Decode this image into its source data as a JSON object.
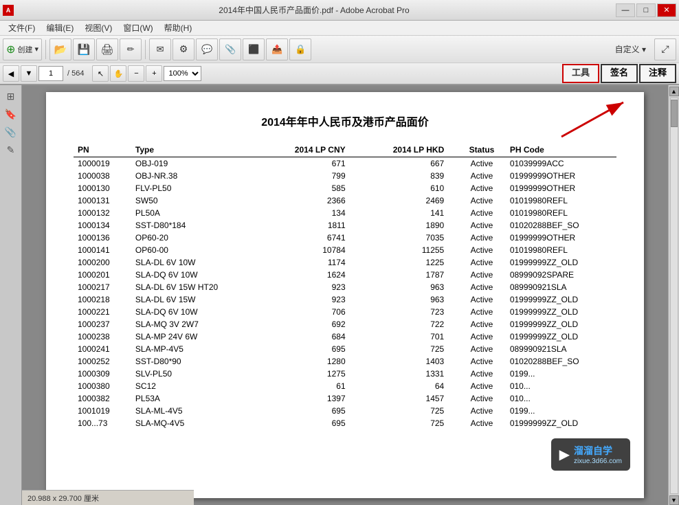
{
  "titlebar": {
    "title": "2014年中国人民币产品面价.pdf - Adobe Acrobat Pro",
    "icon_text": "A",
    "minimize": "—",
    "restore": "□",
    "close": "✕"
  },
  "menubar": {
    "items": [
      "文件(F)",
      "编辑(E)",
      "视图(V)",
      "窗口(W)",
      "帮助(H)"
    ]
  },
  "toolbar": {
    "create_label": "创建",
    "customize_label": "自定义 ▾"
  },
  "navtoolbar": {
    "page_current": "1",
    "page_total": "/ 564",
    "zoom_value": "100%",
    "tools_label": "工具",
    "sign_label": "签名",
    "annotate_label": "注释"
  },
  "pdf": {
    "title": "2014年年中人民币及港币产品面价",
    "columns": [
      "PN",
      "Type",
      "2014 LP CNY",
      "2014 LP HKD",
      "Status",
      "PH Code"
    ],
    "rows": [
      {
        "pn": "1000019",
        "type": "OBJ-019",
        "cny": "671",
        "hkd": "667",
        "status": "Active",
        "ph": "01039999ACC"
      },
      {
        "pn": "1000038",
        "type": "OBJ-NR.38",
        "cny": "799",
        "hkd": "839",
        "status": "Active",
        "ph": "01999999OTHER"
      },
      {
        "pn": "1000130",
        "type": "FLV-PL50",
        "cny": "585",
        "hkd": "610",
        "status": "Active",
        "ph": "01999999OTHER"
      },
      {
        "pn": "1000131",
        "type": "SW50",
        "cny": "2366",
        "hkd": "2469",
        "status": "Active",
        "ph": "01019980REFL"
      },
      {
        "pn": "1000132",
        "type": "PL50A",
        "cny": "134",
        "hkd": "141",
        "status": "Active",
        "ph": "01019980REFL"
      },
      {
        "pn": "1000134",
        "type": "SST-D80*184",
        "cny": "1811",
        "hkd": "1890",
        "status": "Active",
        "ph": "01020288BEF_SO"
      },
      {
        "pn": "1000136",
        "type": "OP60-20",
        "cny": "6741",
        "hkd": "7035",
        "status": "Active",
        "ph": "01999999OTHER"
      },
      {
        "pn": "1000141",
        "type": "OP60-00",
        "cny": "10784",
        "hkd": "11255",
        "status": "Active",
        "ph": "01019980REFL"
      },
      {
        "pn": "1000200",
        "type": "SLA-DL  6V 10W",
        "cny": "1174",
        "hkd": "1225",
        "status": "Active",
        "ph": "01999999ZZ_OLD"
      },
      {
        "pn": "1000201",
        "type": "SLA-DQ  6V 10W",
        "cny": "1624",
        "hkd": "1787",
        "status": "Active",
        "ph": "08999092SPARE"
      },
      {
        "pn": "1000217",
        "type": "SLA-DL 6V 15W HT20",
        "cny": "923",
        "hkd": "963",
        "status": "Active",
        "ph": "089990921SLA"
      },
      {
        "pn": "1000218",
        "type": "SLA-DL  6V 15W",
        "cny": "923",
        "hkd": "963",
        "status": "Active",
        "ph": "01999999ZZ_OLD"
      },
      {
        "pn": "1000221",
        "type": "SLA-DQ  6V 10W",
        "cny": "706",
        "hkd": "723",
        "status": "Active",
        "ph": "01999999ZZ_OLD"
      },
      {
        "pn": "1000237",
        "type": "SLA-MQ  3V  2W7",
        "cny": "692",
        "hkd": "722",
        "status": "Active",
        "ph": "01999999ZZ_OLD"
      },
      {
        "pn": "1000238",
        "type": "SLA-MP  24V  6W",
        "cny": "684",
        "hkd": "701",
        "status": "Active",
        "ph": "01999999ZZ_OLD"
      },
      {
        "pn": "1000241",
        "type": "SLA-MP-4V5",
        "cny": "695",
        "hkd": "725",
        "status": "Active",
        "ph": "089990921SLA"
      },
      {
        "pn": "1000252",
        "type": "SST-D80*90",
        "cny": "1280",
        "hkd": "1403",
        "status": "Active",
        "ph": "01020288BEF_SO"
      },
      {
        "pn": "1000309",
        "type": "SLV-PL50",
        "cny": "1275",
        "hkd": "1331",
        "status": "Active",
        "ph": "0199..."
      },
      {
        "pn": "1000380",
        "type": "SC12",
        "cny": "61",
        "hkd": "64",
        "status": "Active",
        "ph": "010..."
      },
      {
        "pn": "1000382",
        "type": "PL53A",
        "cny": "1397",
        "hkd": "1457",
        "status": "Active",
        "ph": "010..."
      },
      {
        "pn": "1001019",
        "type": "SLA-ML-4V5",
        "cny": "695",
        "hkd": "725",
        "status": "Active",
        "ph": "0199..."
      },
      {
        "pn": "100...73",
        "type": "SLA-MQ-4V5",
        "cny": "695",
        "hkd": "725",
        "status": "Active",
        "ph": "01999999ZZ_OLD"
      }
    ]
  },
  "watermark": {
    "logo": "溜溜自学",
    "url": "zixue.3d66.com"
  },
  "statusbar": {
    "text": "20.988 x 29.700 厘米"
  }
}
